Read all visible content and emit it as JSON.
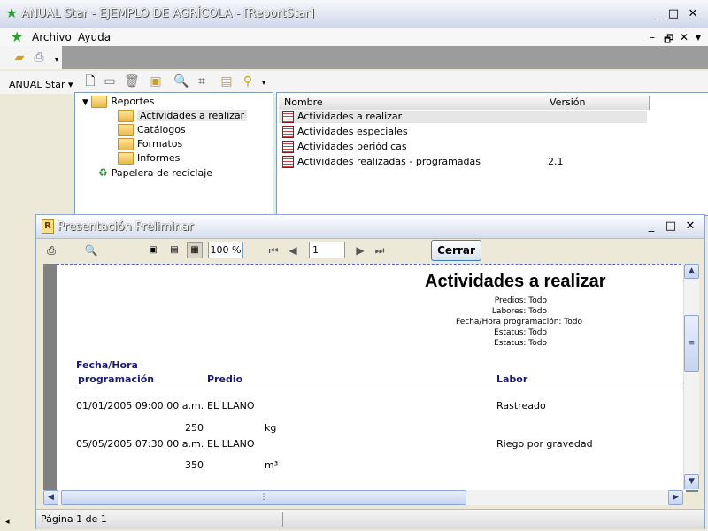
{
  "window": {
    "title": "ANUAL Star - EJEMPLO DE AGRÍCOLA - [ReportStar]",
    "minimize": "_",
    "maximize": "□",
    "close": "✕"
  },
  "menu": {
    "items": [
      "Archivo",
      "Ayuda"
    ],
    "mdi_controls": [
      "–",
      "🗗",
      "✕",
      "▾"
    ]
  },
  "toolbar2": {
    "dropdown_label": "ANUAL Star"
  },
  "tree": {
    "root": "Reportes",
    "children": [
      "Actividades a realizar",
      "Catálogos",
      "Formatos",
      "Informes"
    ],
    "recycle": "Papelera de reciclaje"
  },
  "list": {
    "columns": [
      "Nombre",
      "Versión"
    ],
    "rows": [
      {
        "name": "Actividades a realizar",
        "version": ""
      },
      {
        "name": "Actividades especiales",
        "version": ""
      },
      {
        "name": "Actividades periódicas",
        "version": ""
      },
      {
        "name": "Actividades realizadas - programadas",
        "version": "2.1"
      }
    ]
  },
  "preview": {
    "title": "Presentación Preliminar",
    "zoom": "100 %",
    "page_input": "1",
    "close_button": "Cerrar",
    "status": "Página 1 de 1"
  },
  "report": {
    "title": "Actividades a realizar",
    "filters": [
      "Predios: Todo",
      "Labores: Todo",
      "Fecha/Hora programación: Todo",
      "Estatus: Todo",
      "Estatus: Todo"
    ],
    "col_fecha_1": "Fecha/Hora",
    "col_fecha_2": "programación",
    "col_predio": "Predio",
    "col_labor": "Labor",
    "rows": [
      {
        "fecha": "01/01/2005 09:00:00 a.m.",
        "predio": "EL LLANO",
        "labor": "Rastreado",
        "qty": "250",
        "unit": "kg"
      },
      {
        "fecha": "05/05/2005 07:30:00 a.m.",
        "predio": "EL LLANO",
        "labor": "Riego por gravedad",
        "qty": "350",
        "unit": "m³"
      }
    ]
  },
  "colors": {
    "accent": "#3c7fb1",
    "header_text": "#1a1a72",
    "page_bg": "#808080"
  }
}
